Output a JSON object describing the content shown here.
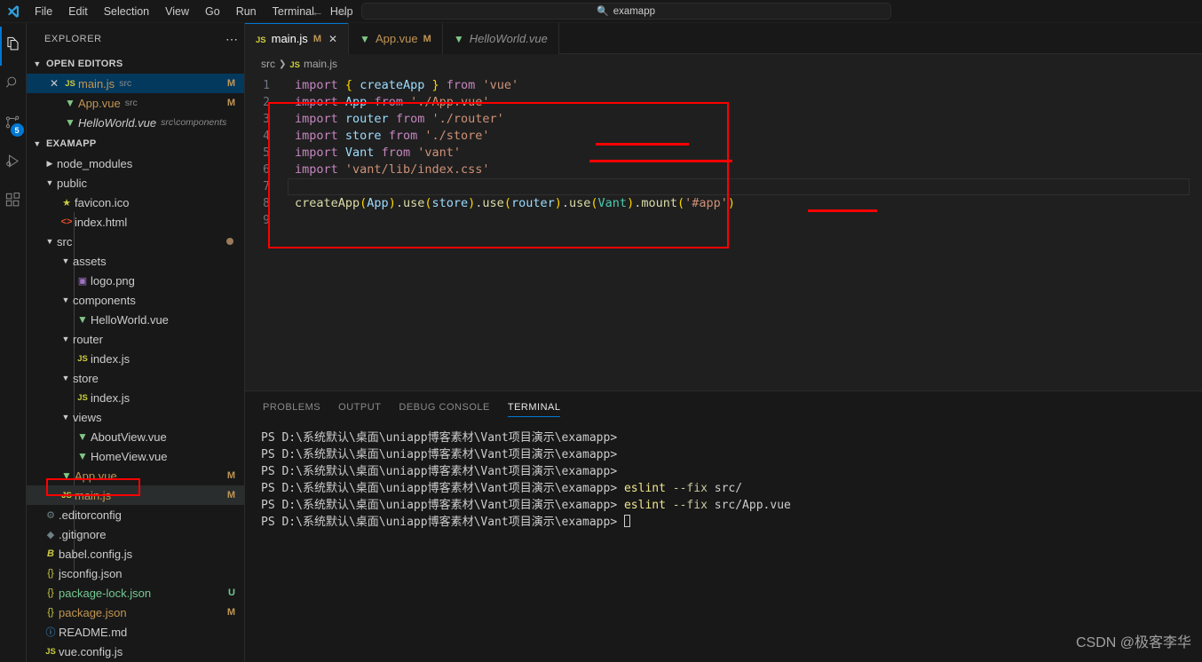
{
  "titlebar": {
    "logo_icon": "vscode-logo-icon",
    "menus": [
      "File",
      "Edit",
      "Selection",
      "View",
      "Go",
      "Run",
      "Terminal",
      "Help"
    ],
    "back_icon": "arrow-left-icon",
    "forward_icon": "arrow-right-icon",
    "search_icon": "search-icon",
    "command_center_value": "examapp"
  },
  "activitybar": {
    "items": [
      {
        "name": "explorer",
        "icon": "files-icon",
        "active": true,
        "badge": ""
      },
      {
        "name": "search",
        "icon": "search-icon",
        "active": false,
        "badge": ""
      },
      {
        "name": "source-control",
        "icon": "source-control-icon",
        "active": false,
        "badge": "5"
      },
      {
        "name": "run-and-debug",
        "icon": "run-debug-icon",
        "active": false,
        "badge": ""
      },
      {
        "name": "extensions",
        "icon": "extensions-icon",
        "active": false,
        "badge": ""
      }
    ]
  },
  "sidebar": {
    "title": "EXPLORER",
    "more_actions_icon": "ellipsis-icon",
    "open_editors": {
      "label": "OPEN EDITORS",
      "items": [
        {
          "name": "main.js",
          "path": "src",
          "icon": "js-icon",
          "status": "M",
          "active": true,
          "italic": false
        },
        {
          "name": "App.vue",
          "path": "src",
          "icon": "vue-icon",
          "status": "M",
          "active": false,
          "italic": false
        },
        {
          "name": "HelloWorld.vue",
          "path": "src\\components",
          "icon": "vue-icon",
          "status": "",
          "active": false,
          "italic": true
        }
      ]
    },
    "project": {
      "label": "EXAMAPP",
      "tree": [
        {
          "name": "node_modules",
          "type": "folder",
          "depth": 1,
          "expanded": false,
          "icon": "chevron-right-icon",
          "status": ""
        },
        {
          "name": "public",
          "type": "folder",
          "depth": 1,
          "expanded": true,
          "icon": "chevron-down-icon",
          "status": ""
        },
        {
          "name": "favicon.ico",
          "type": "file",
          "depth": 2,
          "icon": "star-icon",
          "status": ""
        },
        {
          "name": "index.html",
          "type": "file",
          "depth": 2,
          "icon": "html-icon",
          "status": ""
        },
        {
          "name": "src",
          "type": "folder",
          "depth": 1,
          "expanded": true,
          "icon": "chevron-down-icon",
          "status": "dot"
        },
        {
          "name": "assets",
          "type": "folder",
          "depth": 2,
          "expanded": true,
          "icon": "chevron-down-icon",
          "status": ""
        },
        {
          "name": "logo.png",
          "type": "file",
          "depth": 3,
          "icon": "image-icon",
          "status": ""
        },
        {
          "name": "components",
          "type": "folder",
          "depth": 2,
          "expanded": true,
          "icon": "chevron-down-icon",
          "status": ""
        },
        {
          "name": "HelloWorld.vue",
          "type": "file",
          "depth": 3,
          "icon": "vue-icon",
          "status": ""
        },
        {
          "name": "router",
          "type": "folder",
          "depth": 2,
          "expanded": true,
          "icon": "chevron-down-icon",
          "status": ""
        },
        {
          "name": "index.js",
          "type": "file",
          "depth": 3,
          "icon": "js-icon",
          "status": ""
        },
        {
          "name": "store",
          "type": "folder",
          "depth": 2,
          "expanded": true,
          "icon": "chevron-down-icon",
          "status": ""
        },
        {
          "name": "index.js",
          "type": "file",
          "depth": 3,
          "icon": "js-icon",
          "status": ""
        },
        {
          "name": "views",
          "type": "folder",
          "depth": 2,
          "expanded": true,
          "icon": "chevron-down-icon",
          "status": ""
        },
        {
          "name": "AboutView.vue",
          "type": "file",
          "depth": 3,
          "icon": "vue-icon",
          "status": ""
        },
        {
          "name": "HomeView.vue",
          "type": "file",
          "depth": 3,
          "icon": "vue-icon",
          "status": ""
        },
        {
          "name": "App.vue",
          "type": "file",
          "depth": 2,
          "icon": "vue-icon",
          "status": "M"
        },
        {
          "name": "main.js",
          "type": "file",
          "depth": 2,
          "icon": "js-icon",
          "status": "M",
          "selected": true,
          "annotated": true
        },
        {
          "name": ".editorconfig",
          "type": "file",
          "depth": 1,
          "icon": "gear-icon",
          "status": ""
        },
        {
          "name": ".gitignore",
          "type": "file",
          "depth": 1,
          "icon": "git-icon",
          "status": ""
        },
        {
          "name": "babel.config.js",
          "type": "file",
          "depth": 1,
          "icon": "babel-icon",
          "status": ""
        },
        {
          "name": "jsconfig.json",
          "type": "file",
          "depth": 1,
          "icon": "json-icon",
          "status": ""
        },
        {
          "name": "package-lock.json",
          "type": "file",
          "depth": 1,
          "icon": "json-icon",
          "status": "U"
        },
        {
          "name": "package.json",
          "type": "file",
          "depth": 1,
          "icon": "json-icon",
          "status": "M"
        },
        {
          "name": "README.md",
          "type": "file",
          "depth": 1,
          "icon": "info-icon",
          "status": ""
        },
        {
          "name": "vue.config.js",
          "type": "file",
          "depth": 1,
          "icon": "js-icon",
          "status": ""
        }
      ]
    }
  },
  "editor": {
    "tabs": [
      {
        "label": "main.js",
        "icon": "js-icon",
        "modified": "M",
        "active": true,
        "italic": false,
        "close_icon": "close-icon"
      },
      {
        "label": "App.vue",
        "icon": "vue-icon",
        "modified": "M",
        "active": false,
        "italic": false,
        "close_icon": ""
      },
      {
        "label": "HelloWorld.vue",
        "icon": "vue-icon",
        "modified": "",
        "active": false,
        "italic": true,
        "close_icon": ""
      }
    ],
    "breadcrumb": {
      "folder": "src",
      "separator_icon": "chevron-right-icon",
      "file_icon": "js-icon",
      "file": "main.js"
    },
    "filename": "main.js",
    "lines": [
      {
        "n": "1",
        "gutter": "",
        "text": "import { createApp } from 'vue'"
      },
      {
        "n": "2",
        "gutter": "",
        "text": "import App from './App.vue'"
      },
      {
        "n": "3",
        "gutter": "",
        "text": "import router from './router'"
      },
      {
        "n": "4",
        "gutter": "",
        "text": "import store from './store'"
      },
      {
        "n": "5",
        "gutter": "added",
        "text": "import Vant from 'vant'"
      },
      {
        "n": "6",
        "gutter": "added",
        "text": "import 'vant/lib/index.css'"
      },
      {
        "n": "7",
        "gutter": "",
        "text": ""
      },
      {
        "n": "8",
        "gutter": "modified",
        "text": "createApp(App).use(store).use(router).use(Vant).mount('#app')"
      },
      {
        "n": "9",
        "gutter": "",
        "text": ""
      }
    ],
    "annotation_color": "#ff0000"
  },
  "panel": {
    "tabs": [
      "PROBLEMS",
      "OUTPUT",
      "DEBUG CONSOLE",
      "TERMINAL"
    ],
    "active_tab": "TERMINAL",
    "terminal": {
      "prompt": "PS D:\\系统默认\\桌面\\uniapp博客素材\\Vant项目演示\\examapp>",
      "lines": [
        {
          "prompt": "PS D:\\系统默认\\桌面\\uniapp博客素材\\Vant项目演示\\examapp>",
          "command": "",
          "cursor": false
        },
        {
          "prompt": "PS D:\\系统默认\\桌面\\uniapp博客素材\\Vant项目演示\\examapp>",
          "command": "",
          "cursor": false
        },
        {
          "prompt": "PS D:\\系统默认\\桌面\\uniapp博客素材\\Vant项目演示\\examapp>",
          "command": "",
          "cursor": false
        },
        {
          "prompt": "PS D:\\系统默认\\桌面\\uniapp博客素材\\Vant项目演示\\examapp>",
          "command": "eslint",
          "flag": "--fix",
          "arg": "src/",
          "cursor": false
        },
        {
          "prompt": "PS D:\\系统默认\\桌面\\uniapp博客素材\\Vant项目演示\\examapp>",
          "command": "eslint",
          "flag": "--fix",
          "arg": "src/App.vue",
          "cursor": false
        },
        {
          "prompt": "PS D:\\系统默认\\桌面\\uniapp博客素材\\Vant项目演示\\examapp>",
          "command": "",
          "cursor": true
        }
      ]
    }
  },
  "watermark": "CSDN @极客李华"
}
